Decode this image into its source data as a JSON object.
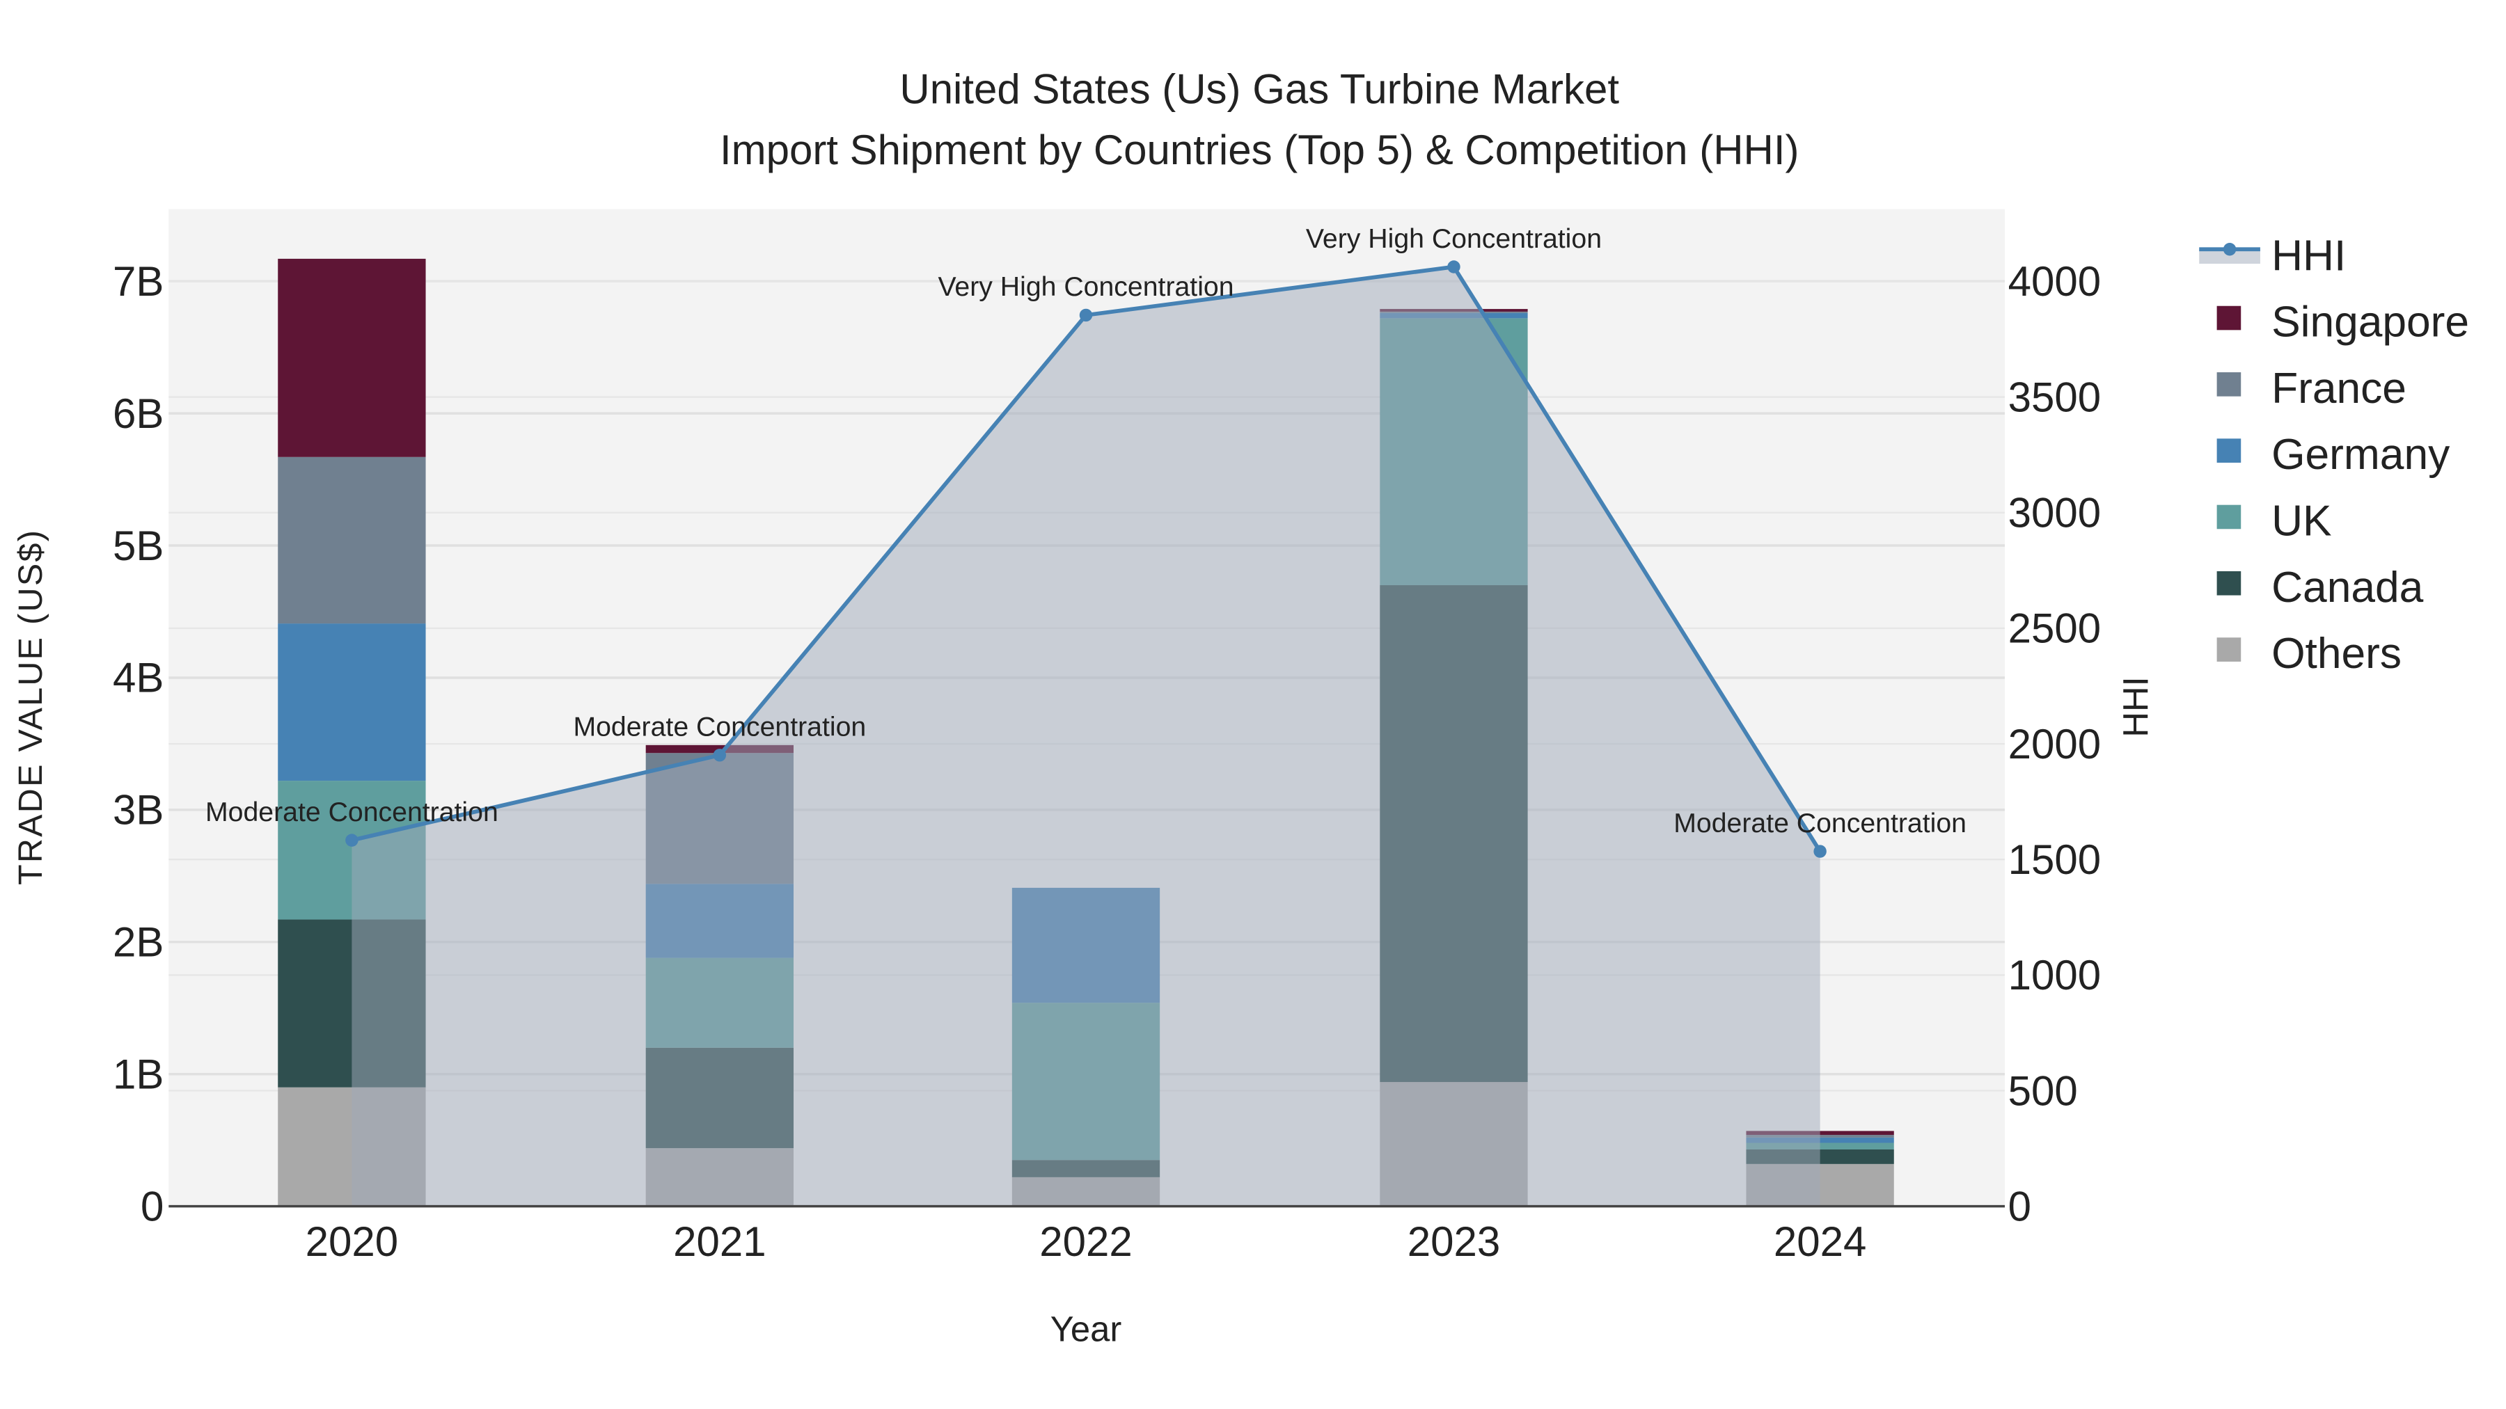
{
  "chart_data": {
    "type": "bar",
    "title": "United States (Us) Gas Turbine Market",
    "subtitle": "Import Shipment by Countries (Top 5) & Competition (HHI)",
    "xlabel": "Year",
    "ylabel": "TRADE VALUE (US$)",
    "y2label": "HHI",
    "categories": [
      "2020",
      "2021",
      "2022",
      "2023",
      "2024"
    ],
    "ylim": [
      0,
      7.5
    ],
    "y_ticks": [
      0,
      1,
      2,
      3,
      4,
      5,
      6,
      7
    ],
    "y_tick_labels": [
      "0",
      "1B",
      "2B",
      "3B",
      "4B",
      "5B",
      "6B",
      "7B"
    ],
    "y2lim": [
      0,
      4300
    ],
    "y2_ticks": [
      0,
      500,
      1000,
      1500,
      2000,
      2500,
      3000,
      3500,
      4000
    ],
    "y2_tick_labels": [
      "0",
      "500",
      "1000",
      "1500",
      "2000",
      "2500",
      "3000",
      "3500",
      "4000"
    ],
    "units": "billion US$",
    "series": [
      {
        "name": "Others",
        "color": "#a9a9a9",
        "values": [
          0.9,
          0.44,
          0.22,
          0.94,
          0.32
        ]
      },
      {
        "name": "Canada",
        "color": "#2f4f4f",
        "values": [
          1.27,
          0.76,
          0.13,
          3.76,
          0.11
        ]
      },
      {
        "name": "UK",
        "color": "#5f9e9e",
        "values": [
          1.05,
          0.68,
          1.19,
          2.02,
          0.05
        ]
      },
      {
        "name": "Germany",
        "color": "#4682b4",
        "values": [
          1.19,
          0.56,
          0.87,
          0.04,
          0.04
        ]
      },
      {
        "name": "France",
        "color": "#708090",
        "values": [
          1.26,
          0.99,
          0.0,
          0.01,
          0.02
        ]
      },
      {
        "name": "Singapore",
        "color": "#5e1535",
        "values": [
          1.5,
          0.06,
          0.0,
          0.02,
          0.03
        ]
      }
    ],
    "hhi": {
      "name": "HHI",
      "color": "#4682b4",
      "values": [
        1583,
        1951,
        3854,
        4063,
        1535
      ],
      "annotations": [
        "Moderate Concentration",
        "Moderate Concentration",
        "Very High Concentration",
        "Very High Concentration",
        "Moderate Concentration"
      ]
    },
    "legend": {
      "placement": "right",
      "order": [
        "HHI",
        "Singapore",
        "France",
        "Germany",
        "UK",
        "Canada",
        "Others"
      ]
    },
    "grid": true
  }
}
